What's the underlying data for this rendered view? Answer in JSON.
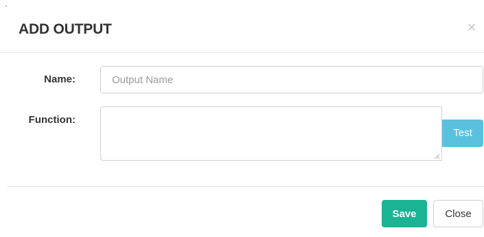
{
  "modal": {
    "title": "ADD OUTPUT",
    "close_icon": "×"
  },
  "form": {
    "name": {
      "label": "Name:",
      "value": "",
      "placeholder": "Output Name"
    },
    "function": {
      "label": "Function:",
      "value": "",
      "test_label": "Test"
    }
  },
  "footer": {
    "save_label": "Save",
    "close_label": "Close"
  },
  "colors": {
    "save_button": "#1ab394",
    "test_button": "#5bc0de",
    "border": "#cfcfcf",
    "divider": "#e5e5e5"
  },
  "icons": {
    "close": "close-icon",
    "resize": "resize-grip-icon"
  }
}
